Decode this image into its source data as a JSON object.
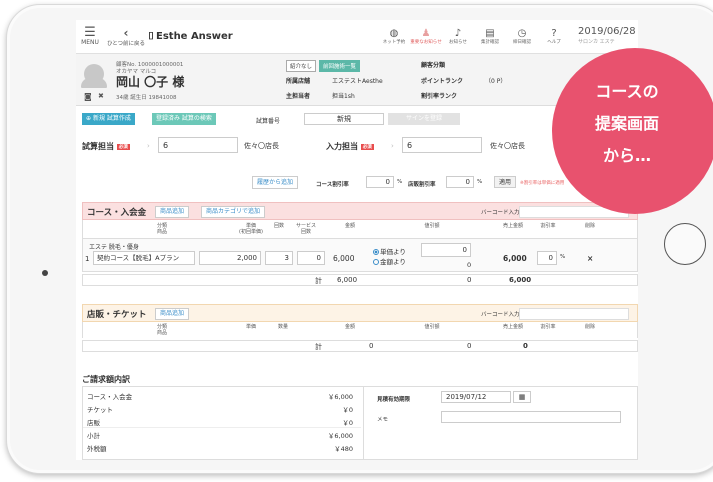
{
  "nav": {
    "menu_label": "MENU",
    "back_label": "ひとつ前に戻る",
    "logo": "Esthe Answer",
    "icons": [
      {
        "label": "ネット予約",
        "icon": "globe-icon"
      },
      {
        "label": "重要なお知らせ",
        "icon": "alert-icon"
      },
      {
        "label": "お知らせ",
        "icon": "bell-icon"
      },
      {
        "label": "集計確認",
        "icon": "report-icon"
      },
      {
        "label": "締日確認",
        "icon": "clock-icon"
      },
      {
        "label": "ヘルプ",
        "icon": "help-icon"
      }
    ],
    "date": "2019/06/28",
    "date_sub": "サロンカ エステ"
  },
  "customer": {
    "number": "顧客No. 1000001000001",
    "kana": "オカヤマ マルコ",
    "name": "岡山 〇子 様",
    "age": "34歳  誕生日 19841008",
    "tags": [
      "紹介なし",
      "前回施術一覧"
    ],
    "store_label": "所属店舗",
    "store_value": "エステストAesthe",
    "main_staff_label": "主担当者",
    "main_staff_value": "担当1sh",
    "category_label": "顧客分類",
    "point_label": "ポイントランク",
    "point_value": "（0 P）",
    "discount_rank_label": "割引率ランク"
  },
  "actions": {
    "new_trial": "新規 試算作成",
    "search_trial": "登録済み 試算の検索",
    "trial_no_label": "試算番号",
    "trial_no_value": "新規",
    "sign_button": "サインを登録"
  },
  "staff": {
    "trial_staff_label": "試算担当",
    "required": "必須",
    "trial_staff_code": "6",
    "trial_staff_name": "佐々〇店長",
    "input_staff_label": "入力担当",
    "input_staff_code": "6",
    "input_staff_name": "佐々〇店長"
  },
  "discount": {
    "history_button": "履歴から追加",
    "course_rate_label": "コース割引率",
    "course_rate_value": "0",
    "store_rate_label": "店販割引率",
    "store_rate_value": "0",
    "percent": "%",
    "apply_button": "適用",
    "note": "※割引率は単価に適用"
  },
  "course": {
    "title": "コース・入会金",
    "add_product": "商品追加",
    "add_by_category": "商品カテゴリで追加",
    "barcode_label": "バーコード入力",
    "headers": {
      "category": "分類",
      "product": "商品",
      "unit_price": "単価",
      "unit_price_sub": "(初回単価)",
      "count": "回数",
      "service": "サービス",
      "service_sub": "回数",
      "amount": "金額",
      "discount": "値引額",
      "sales": "売上金額",
      "rate": "割引率",
      "delete": "削除"
    },
    "row": {
      "category": "エステ 脱毛・優身",
      "index": "1",
      "product": "契約コース【脱毛】Aプラン",
      "unit_price": "2,000",
      "count": "3",
      "service": "0",
      "amount": "6,000",
      "radio_unit": "単価より",
      "radio_amount": "金額より",
      "discount": "0",
      "discount_sub": "0",
      "sales": "6,000",
      "rate": "0",
      "percent": "%",
      "delete": "×"
    },
    "total_label": "計",
    "total_amount": "6,000",
    "total_discount": "0",
    "total_sales": "6,000"
  },
  "shop": {
    "title": "店販・チケット",
    "add_product": "商品追加",
    "barcode_label": "バーコード入力",
    "headers": {
      "category": "分類",
      "product": "商品",
      "unit_price": "単価",
      "qty": "数量",
      "amount": "金額",
      "discount": "値引額",
      "sales": "売上金額",
      "rate": "割引率",
      "delete": "削除"
    },
    "total_label": "計",
    "total_amount": "0",
    "total_discount": "0",
    "total_sales": "0"
  },
  "billing": {
    "title": "ご請求額内訳",
    "rows": [
      {
        "label": "コース・入会金",
        "value": "￥6,000"
      },
      {
        "label": "チケット",
        "value": "￥0"
      },
      {
        "label": "店販",
        "value": "￥0"
      },
      {
        "label": "小計",
        "value": "￥6,000"
      },
      {
        "label": "外税額",
        "value": "￥480"
      }
    ],
    "valid_label": "見積有効期限",
    "valid_value": "2019/07/12",
    "memo_label": "メモ"
  },
  "bubble": {
    "line1": "コースの",
    "line2": "提案画面",
    "line3": "から…",
    "color": "#e8526e"
  }
}
